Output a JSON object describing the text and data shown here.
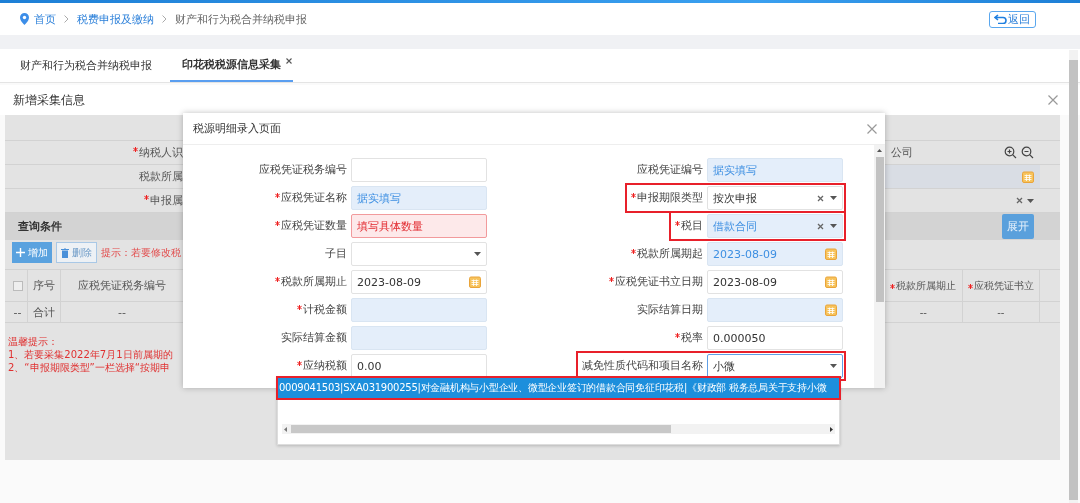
{
  "breadcrumb": [
    {
      "label": "首页",
      "kind": "link"
    },
    {
      "label": "税费申报及缴纳",
      "kind": "link"
    },
    {
      "label": "财产和行为税合并纳税申报",
      "kind": "current"
    }
  ],
  "back_button": "返回",
  "tabs": [
    {
      "label": "财产和行为税合并纳税申报",
      "selected": false,
      "closable": false
    },
    {
      "label": "印花税税源信息采集",
      "selected": true,
      "closable": true
    }
  ],
  "panel": {
    "title": "新增采集信息",
    "form_rows": [
      {
        "label": "纳税人识",
        "required": true,
        "kind": "search",
        "value": "公司"
      },
      {
        "label": "税款所属",
        "required": false,
        "kind": "date"
      },
      {
        "label": "申报属",
        "required": true,
        "kind": "select"
      }
    ],
    "query": {
      "title": "查询条件",
      "expand_button": "展开"
    },
    "add_button": "增加",
    "delete_button": "删除",
    "hint": "提示：若要修改税",
    "table": {
      "select_all_checked": false,
      "columns": [
        "序号",
        "应税凭证税务编号"
      ],
      "right_columns": [
        {
          "label": "税款所属期止",
          "required": true
        },
        {
          "label": "应税凭证书立",
          "required": true
        }
      ],
      "total_row": [
        "--",
        "合计",
        "--"
      ],
      "right_total_row": [
        "--",
        "--"
      ]
    },
    "notes": [
      "温馨提示：",
      "1、若要采集2022年7月1日前属期的",
      "2、“申报期限类型”一栏选择“按期申"
    ]
  },
  "dialog": {
    "title": "税源明细录入页面",
    "left_fields": [
      {
        "label": "应税凭证税务编号",
        "required": false,
        "kind": "text",
        "readonly": false,
        "invalid": false,
        "focused": false,
        "clearable": false,
        "highlighted": false
      },
      {
        "label": "应税凭证名称",
        "required": true,
        "kind": "text",
        "value": "据实填写",
        "readonly": true,
        "invalid": false,
        "focused": false,
        "clearable": false,
        "highlighted": false
      },
      {
        "label": "应税凭证数量",
        "required": true,
        "kind": "text",
        "value": "填写具体数量",
        "readonly": false,
        "invalid": true,
        "focused": false,
        "clearable": false,
        "highlighted": false
      },
      {
        "label": "子目",
        "required": false,
        "kind": "select",
        "readonly": false,
        "invalid": false,
        "focused": false,
        "clearable": false,
        "highlighted": false
      },
      {
        "label": "税款所属期止",
        "required": true,
        "kind": "date",
        "value": "2023-08-09",
        "readonly": false,
        "invalid": false,
        "focused": false,
        "clearable": false,
        "highlighted": false
      },
      {
        "label": "计税金额",
        "required": true,
        "kind": "text",
        "readonly": true,
        "invalid": false,
        "focused": false,
        "clearable": false,
        "highlighted": false
      },
      {
        "label": "实际结算金额",
        "required": false,
        "kind": "text",
        "readonly": true,
        "invalid": false,
        "focused": false,
        "clearable": false,
        "highlighted": false
      },
      {
        "label": "应纳税额",
        "required": true,
        "kind": "text",
        "value": "0.00",
        "readonly": false,
        "invalid": false,
        "focused": false,
        "clearable": false,
        "highlighted": false
      }
    ],
    "right_fields": [
      {
        "label": "应税凭证编号",
        "required": false,
        "kind": "text",
        "value": "据实填写",
        "readonly": true,
        "invalid": false,
        "focused": false,
        "clearable": false,
        "highlighted": false
      },
      {
        "label": "申报期限类型",
        "required": true,
        "kind": "select",
        "value": "按次申报",
        "readonly": false,
        "invalid": false,
        "focused": false,
        "clearable": true,
        "highlighted": true
      },
      {
        "label": "税目",
        "required": true,
        "kind": "select",
        "value": "借款合同",
        "readonly": true,
        "invalid": false,
        "focused": false,
        "clearable": true,
        "highlighted": true
      },
      {
        "label": "税款所属期起",
        "required": true,
        "kind": "date",
        "value": "2023-08-09",
        "readonly": true,
        "invalid": false,
        "focused": false,
        "clearable": false,
        "highlighted": false
      },
      {
        "label": "应税凭证书立日期",
        "required": true,
        "kind": "date",
        "value": "2023-08-09",
        "readonly": false,
        "invalid": false,
        "focused": false,
        "clearable": false,
        "highlighted": false
      },
      {
        "label": "实际结算日期",
        "required": false,
        "kind": "date",
        "readonly": true,
        "invalid": false,
        "focused": false,
        "clearable": false,
        "highlighted": false
      },
      {
        "label": "税率",
        "required": true,
        "kind": "text",
        "value": "0.000050",
        "readonly": false,
        "invalid": false,
        "focused": false,
        "clearable": false,
        "highlighted": false
      },
      {
        "label": "减免性质代码和项目名称",
        "required": false,
        "kind": "select",
        "value": "小微",
        "readonly": false,
        "invalid": false,
        "focused": true,
        "clearable": false,
        "highlighted": true
      }
    ],
    "options": [
      {
        "label": "0009041503|SXA031900255|对金融机构与小型企业、微型企业签订的借款合同免征印花税|《财政部 税务总局关于支持小微",
        "selected": true,
        "highlighted": true
      }
    ]
  }
}
